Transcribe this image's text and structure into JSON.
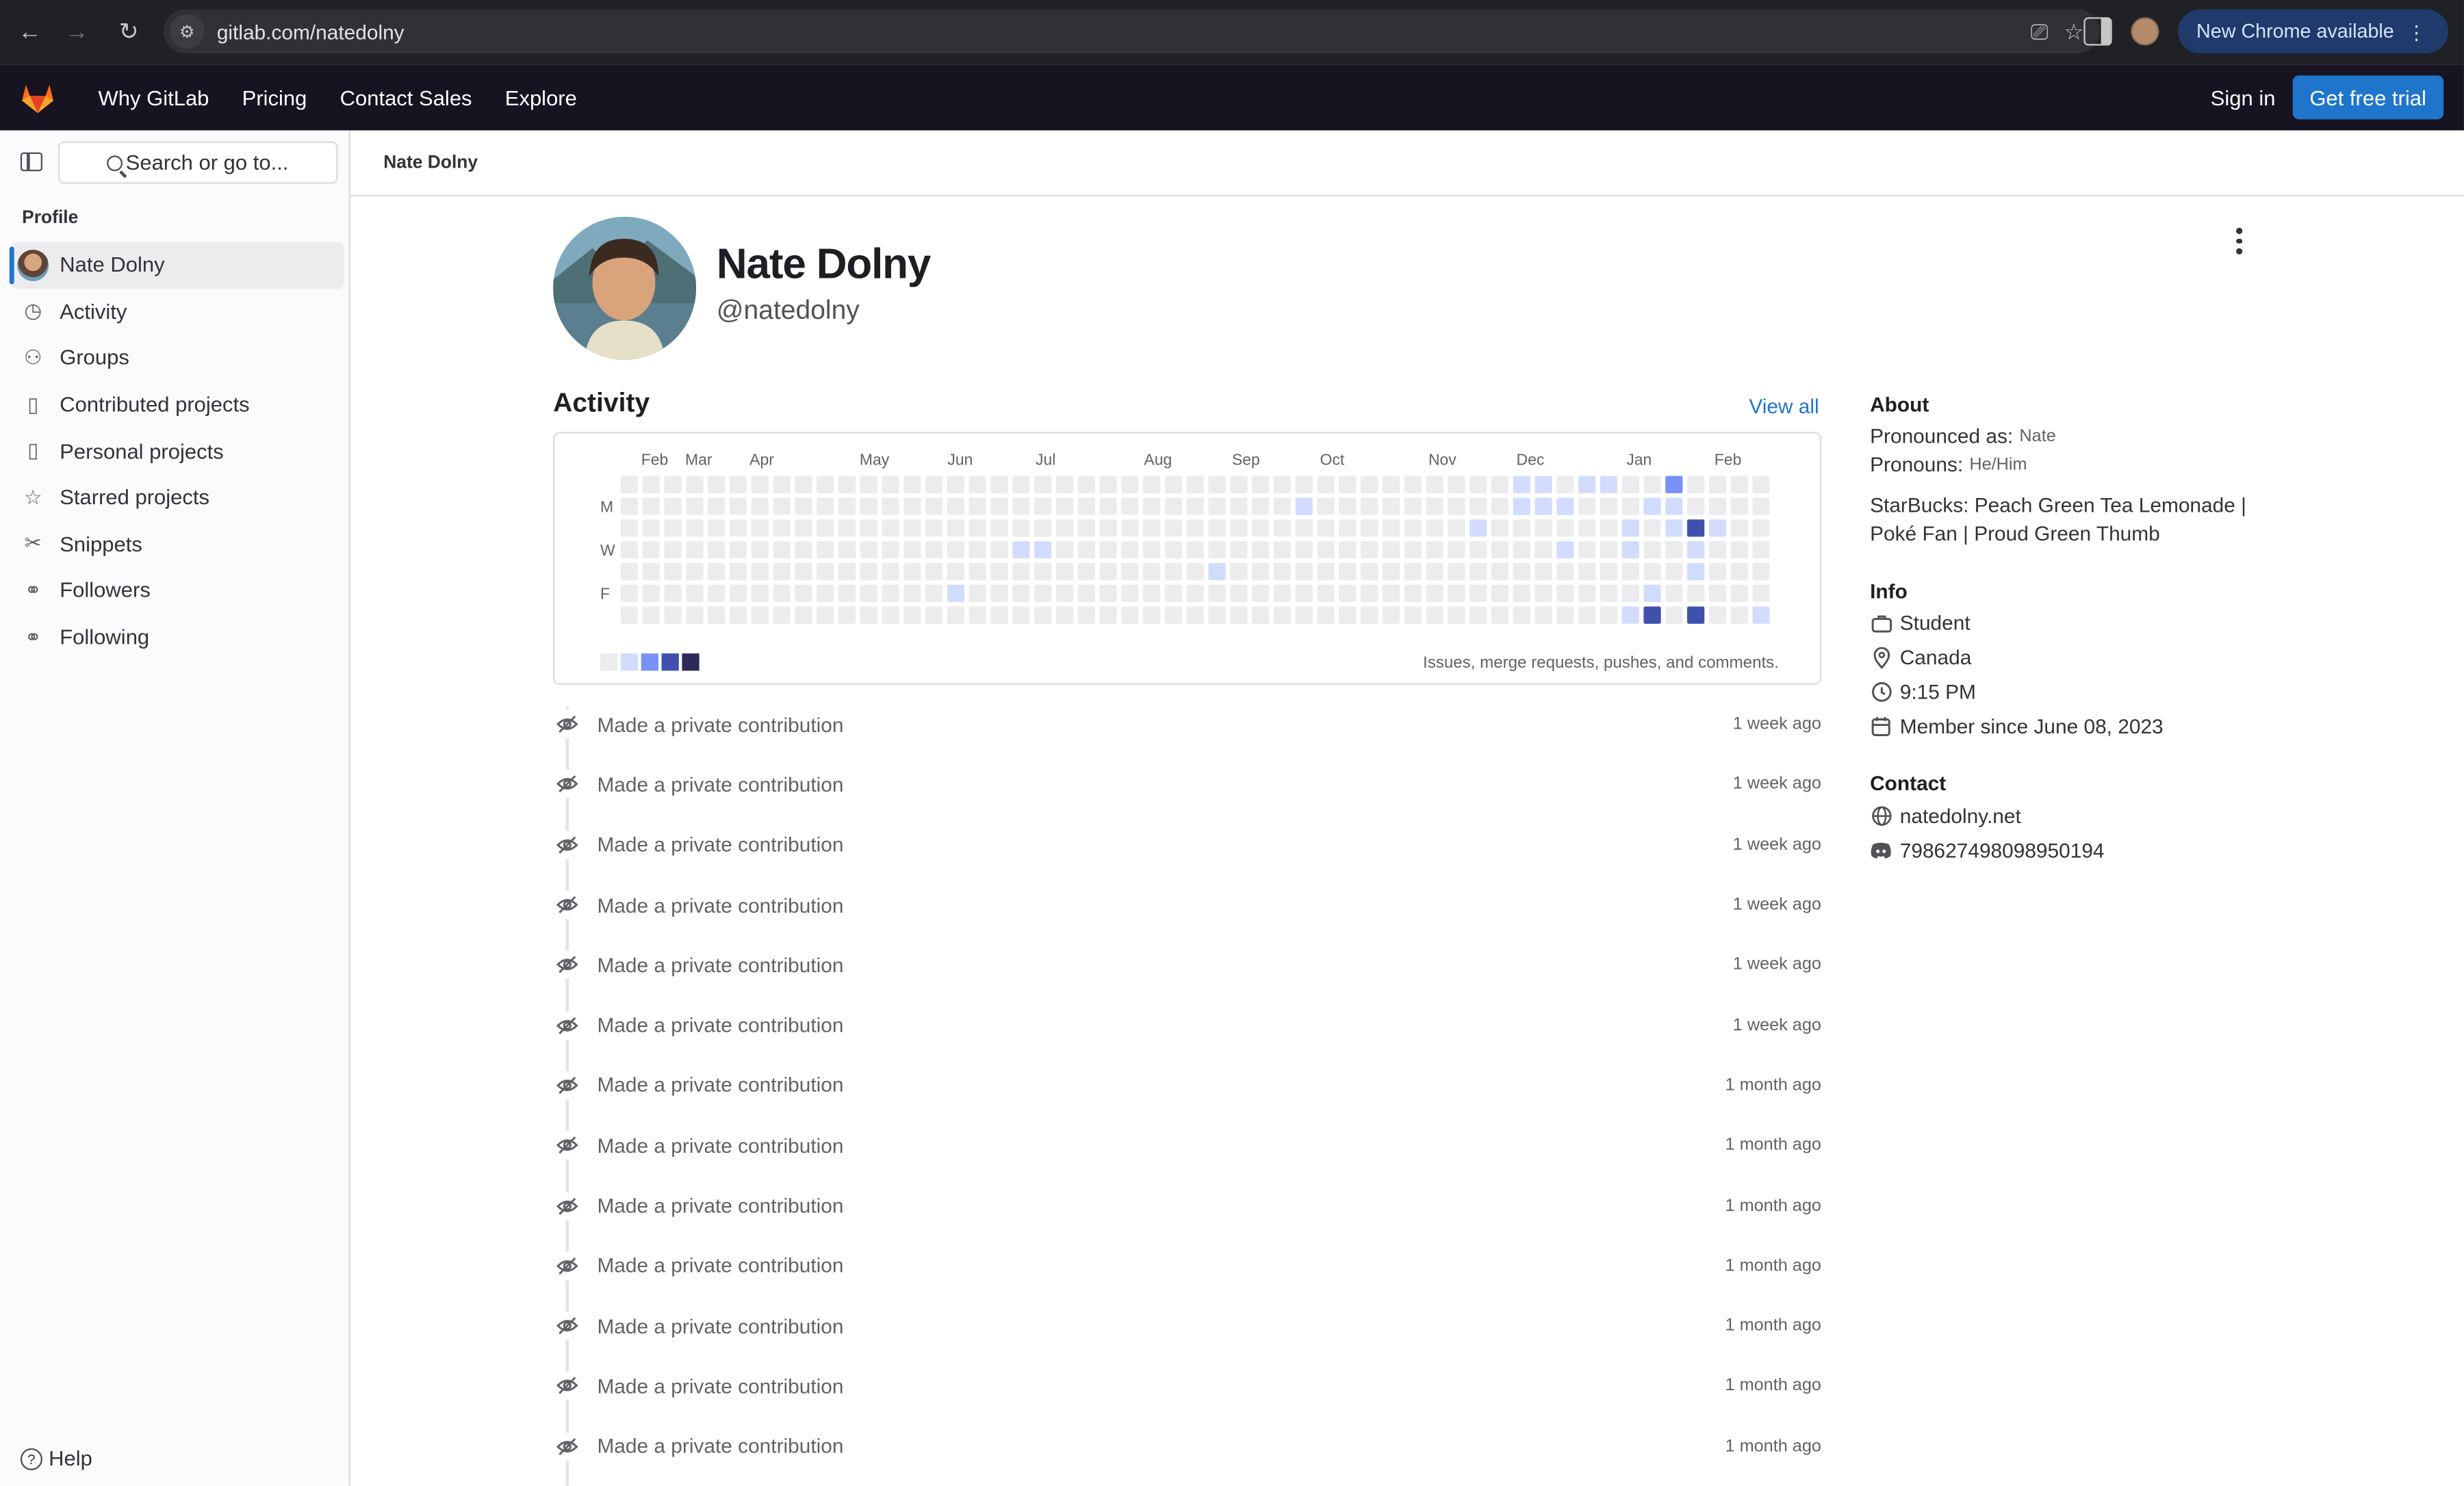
{
  "browser": {
    "url": "gitlab.com/natedolny",
    "update_label": "New Chrome available"
  },
  "topnav": {
    "links": [
      "Why GitLab",
      "Pricing",
      "Contact Sales",
      "Explore"
    ],
    "signin": "Sign in",
    "trial": "Get free trial"
  },
  "sidebar": {
    "search_label": "Search or go to...",
    "section": "Profile",
    "items": [
      {
        "label": "Nate Dolny",
        "icon": "avatar"
      },
      {
        "label": "Activity",
        "icon": "history-icon"
      },
      {
        "label": "Groups",
        "icon": "group-icon"
      },
      {
        "label": "Contributed projects",
        "icon": "project-icon"
      },
      {
        "label": "Personal projects",
        "icon": "project-icon"
      },
      {
        "label": "Starred projects",
        "icon": "star-icon"
      },
      {
        "label": "Snippets",
        "icon": "snippet-icon"
      },
      {
        "label": "Followers",
        "icon": "users-icon"
      },
      {
        "label": "Following",
        "icon": "users-icon"
      }
    ],
    "help": "Help"
  },
  "breadcrumb": "Nate Dolny",
  "profile": {
    "name": "Nate Dolny",
    "handle": "@natedolny"
  },
  "activity": {
    "title": "Activity",
    "view_all": "View all",
    "months": [
      "Feb",
      "Mar",
      "Apr",
      "May",
      "Jun",
      "Jul",
      "Aug",
      "Sep",
      "Oct",
      "Nov",
      "Dec",
      "Jan",
      "Feb"
    ],
    "days": [
      "M",
      "W",
      "F"
    ],
    "legend_note": "Issues, merge requests, pushes, and comments.",
    "levels": [
      "#ececef",
      "#d2dcff",
      "#7992f5",
      "#3f51ae",
      "#2a2b59"
    ]
  },
  "feed": [
    {
      "text": "Made a private contribution",
      "time": "1 week ago"
    },
    {
      "text": "Made a private contribution",
      "time": "1 week ago"
    },
    {
      "text": "Made a private contribution",
      "time": "1 week ago"
    },
    {
      "text": "Made a private contribution",
      "time": "1 week ago"
    },
    {
      "text": "Made a private contribution",
      "time": "1 week ago"
    },
    {
      "text": "Made a private contribution",
      "time": "1 week ago"
    },
    {
      "text": "Made a private contribution",
      "time": "1 month ago"
    },
    {
      "text": "Made a private contribution",
      "time": "1 month ago"
    },
    {
      "text": "Made a private contribution",
      "time": "1 month ago"
    },
    {
      "text": "Made a private contribution",
      "time": "1 month ago"
    },
    {
      "text": "Made a private contribution",
      "time": "1 month ago"
    },
    {
      "text": "Made a private contribution",
      "time": "1 month ago"
    },
    {
      "text": "Made a private contribution",
      "time": "1 month ago"
    }
  ],
  "about": {
    "title": "About",
    "pronounced_label": "Pronounced as:",
    "pronounced_value": "Nate",
    "pronouns_label": "Pronouns:",
    "pronouns_value": "He/Him",
    "bio": "StarBucks: Peach Green Tea Lemonade | Poké Fan | Proud Green Thumb"
  },
  "info": {
    "title": "Info",
    "job": "Student",
    "location": "Canada",
    "time": "9:15 PM",
    "member_since": "Member since June 08, 2023"
  },
  "contact": {
    "title": "Contact",
    "website": "natedolny.net",
    "discord": "798627498098950194"
  }
}
